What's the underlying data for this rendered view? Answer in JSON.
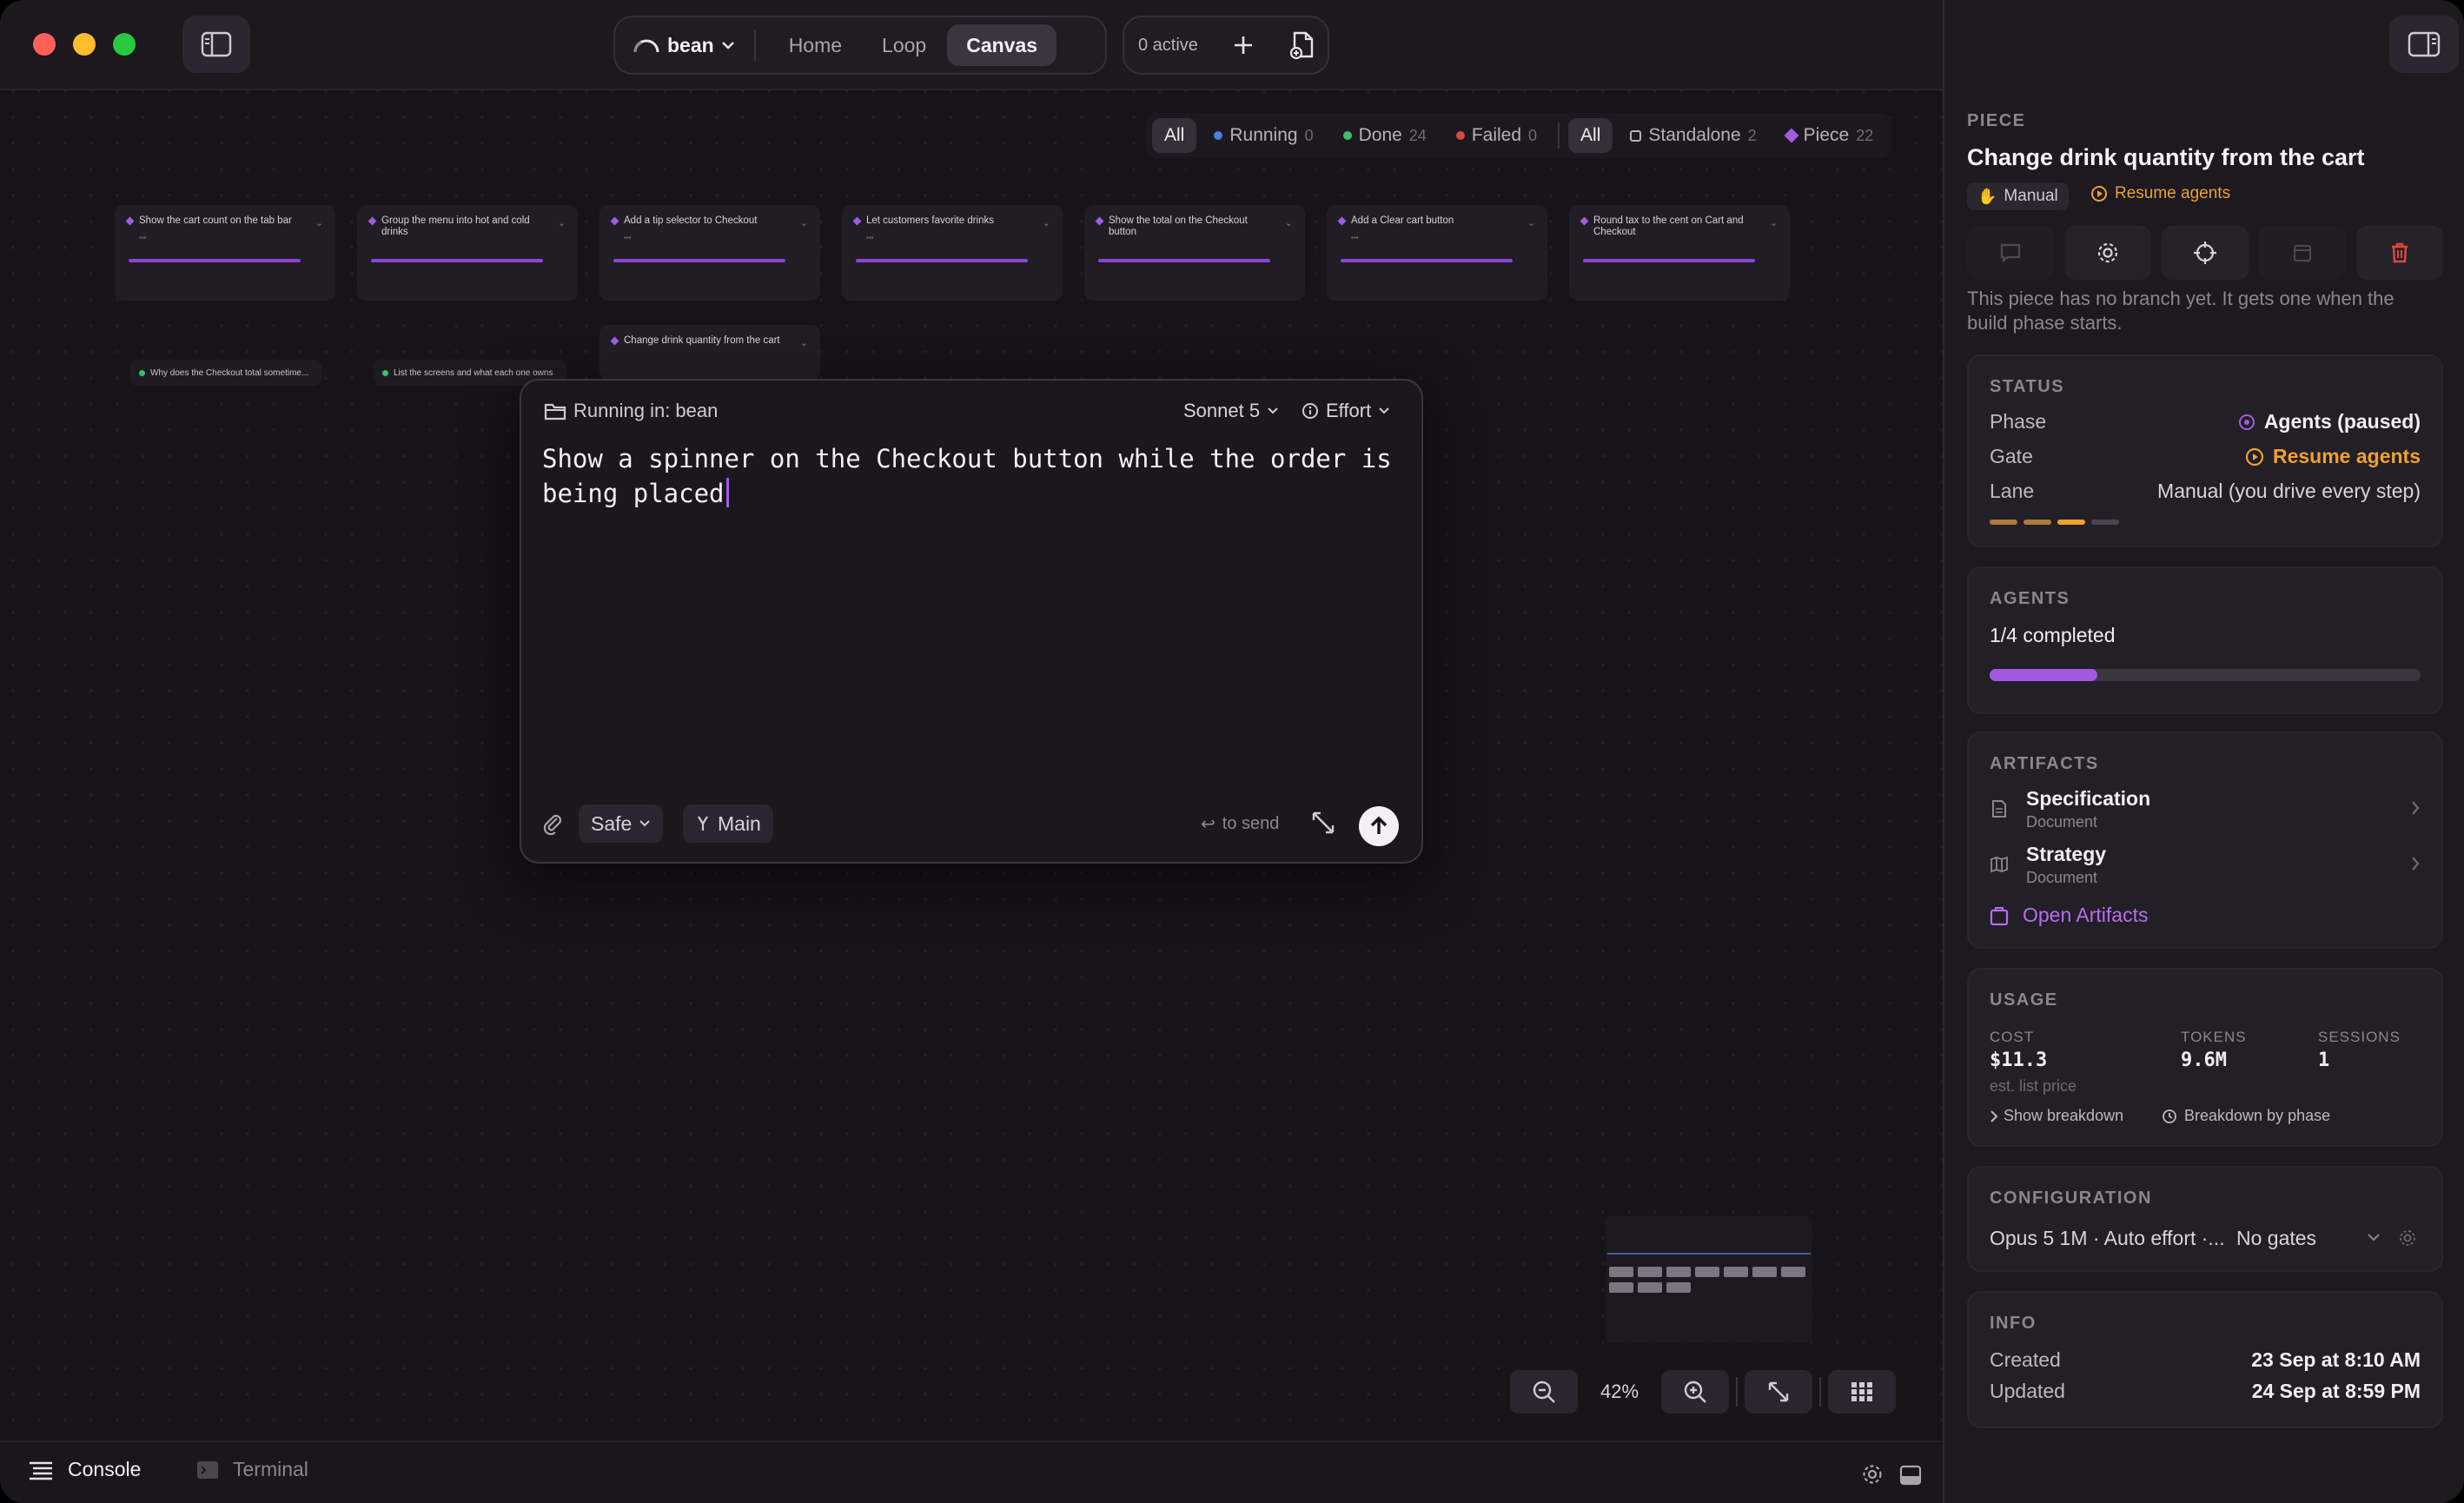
{
  "titlebar": {
    "project": "bean",
    "tabs": [
      {
        "label": "Home",
        "active": false
      },
      {
        "label": "Loop",
        "active": false
      },
      {
        "label": "Canvas",
        "active": true
      }
    ],
    "active_count": "0 active"
  },
  "filters": {
    "status": [
      {
        "label": "All",
        "count": "",
        "color": ""
      },
      {
        "label": "Running",
        "count": "0",
        "color": "#4a7fe0"
      },
      {
        "label": "Done",
        "count": "24",
        "color": "#3fbf6a"
      },
      {
        "label": "Failed",
        "count": "0",
        "color": "#e0473f"
      }
    ],
    "kind": [
      {
        "label": "All",
        "count": ""
      },
      {
        "label": "Standalone",
        "count": "2"
      },
      {
        "label": "Piece",
        "count": "22"
      }
    ]
  },
  "cards": [
    {
      "title": "Show the cart count on the tab bar"
    },
    {
      "title": "Group the menu into hot and cold drinks"
    },
    {
      "title": "Add a tip selector to Checkout"
    },
    {
      "title": "Let customers favorite drinks"
    },
    {
      "title": "Show the total on the Checkout button"
    },
    {
      "title": "Add a Clear cart button"
    },
    {
      "title": "Round tax to the cent on Cart and Checkout"
    },
    {
      "title": "Change drink quantity from the cart"
    }
  ],
  "standalone_cards": [
    {
      "title": "Why does the Checkout total sometime..."
    },
    {
      "title": "List the screens and what each one owns"
    }
  ],
  "composer": {
    "running_in": "Running in: bean",
    "model": "Sonnet 5",
    "effort": "Effort",
    "text": "Show a spinner on the Checkout button while the order is being placed",
    "mode": "Safe",
    "branch": "Main",
    "send_hint": "to send"
  },
  "zoom": {
    "level": "42%"
  },
  "bottombar": {
    "console": "Console",
    "terminal": "Terminal"
  },
  "panel": {
    "section_label": "PIECE",
    "title": "Change drink quantity from the cart",
    "lane_tag": "Manual",
    "resume_tag": "Resume agents",
    "note": "This piece has no branch yet. It gets one when the build phase starts.",
    "status": {
      "label": "STATUS",
      "phase_key": "Phase",
      "phase_val": "Agents (paused)",
      "gate_key": "Gate",
      "gate_val": "Resume agents",
      "lane_key": "Lane",
      "lane_val": "Manual (you drive every step)"
    },
    "agents": {
      "label": "AGENTS",
      "completed": "1/4 completed",
      "progress": 0.25
    },
    "artifacts": {
      "label": "ARTIFACTS",
      "items": [
        {
          "name": "Specification",
          "type": "Document"
        },
        {
          "name": "Strategy",
          "type": "Document"
        }
      ],
      "open": "Open Artifacts"
    },
    "usage": {
      "label": "USAGE",
      "cost_label": "COST",
      "cost": "$11.3",
      "cost_note": "est. list price",
      "tokens_label": "TOKENS",
      "tokens": "9.6M",
      "sessions_label": "SESSIONS",
      "sessions": "1",
      "show_breakdown": "Show breakdown",
      "breakdown_phase": "Breakdown by phase"
    },
    "config": {
      "label": "CONFIGURATION",
      "value": "Opus 5 1M · Auto effort ·...",
      "gates": "No gates"
    },
    "info": {
      "label": "INFO",
      "created_key": "Created",
      "created": "23 Sep at 8:10 AM",
      "updated_key": "Updated",
      "updated": "24 Sep at 8:59 PM"
    }
  },
  "colors": {
    "accent": "#a35ae0",
    "orange": "#f0a030",
    "danger": "#e0473f"
  }
}
